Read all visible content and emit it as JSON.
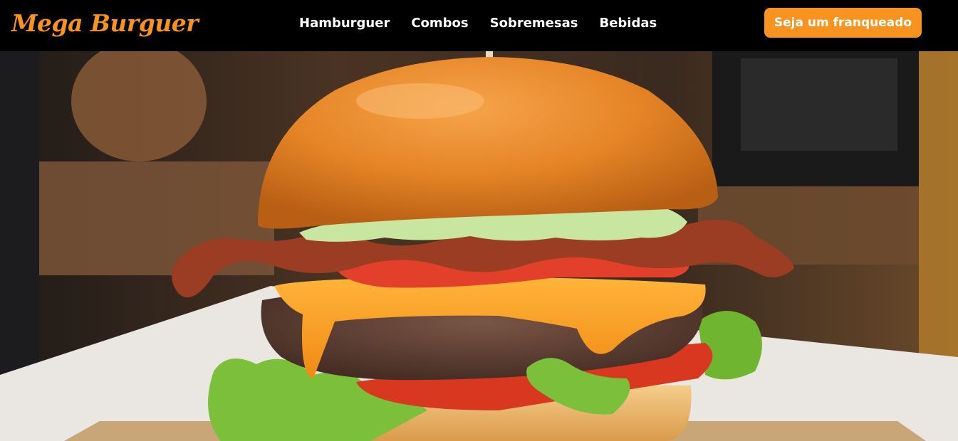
{
  "navbar": {
    "logo": "Mega Burguer",
    "links": [
      {
        "label": "Hamburguer"
      },
      {
        "label": "Combos"
      },
      {
        "label": "Sobremesas"
      },
      {
        "label": "Bebidas"
      }
    ],
    "cta_label": "Seja um franqueado"
  },
  "hero": {
    "image": "burger-photo"
  },
  "colors": {
    "brand_orange": "#f7931e",
    "navbar_bg": "#000000",
    "nav_text": "#ffffff"
  }
}
